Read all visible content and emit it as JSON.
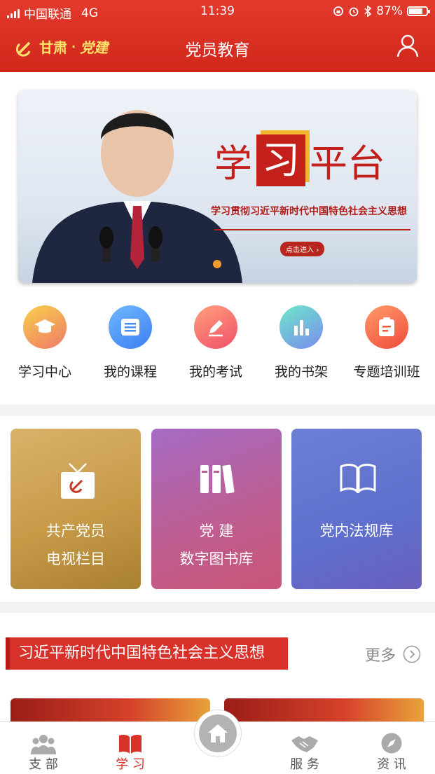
{
  "status": {
    "carrier": "中国联通",
    "network": "4G",
    "time": "11:39",
    "battery": "87%",
    "battery_level": 0.87
  },
  "nav": {
    "logo_text": "甘肃",
    "logo_sub": "党建",
    "logo_sep": "·",
    "title": "党员教育"
  },
  "banner": {
    "heading_left": "学",
    "heading_box": "习",
    "heading_right": "平台",
    "subtitle": "学习贯彻习近平新时代中国特色社会主义思想",
    "button": "点击进入",
    "button_arrow": "›"
  },
  "quick": [
    {
      "label": "学习中心",
      "icon": "graduation-cap-icon",
      "color_a": "#f7d04a",
      "color_b": "#f07a6a"
    },
    {
      "label": "我的课程",
      "icon": "course-list-icon",
      "color_a": "#6fb7ff",
      "color_b": "#3e7ff2"
    },
    {
      "label": "我的考试",
      "icon": "pencil-icon",
      "color_a": "#ffa07a",
      "color_b": "#f0506a"
    },
    {
      "label": "我的书架",
      "icon": "bar-chart-icon",
      "color_a": "#6ee7c8",
      "color_b": "#7a8cf0"
    },
    {
      "label": "专题培训班",
      "icon": "clipboard-icon",
      "color_a": "#ff9c6a",
      "color_b": "#ef4a3a"
    }
  ],
  "cards": [
    {
      "line1": "共产党员",
      "line2": "电视栏目",
      "icon": "tv-icon"
    },
    {
      "line1": "党 建",
      "line2": "数字图书库",
      "icon": "books-icon"
    },
    {
      "line1": "党内法规库",
      "line2": "",
      "icon": "open-book-icon"
    }
  ],
  "section": {
    "title": "习近平新时代中国特色社会主义思想",
    "more": "更多"
  },
  "tabs": [
    {
      "label": "支 部",
      "icon": "group-icon"
    },
    {
      "label": "学 习",
      "icon": "study-book-icon"
    },
    {
      "label": "服 务",
      "icon": "handshake-icon"
    },
    {
      "label": "资 讯",
      "icon": "compass-icon"
    }
  ],
  "colors": {
    "primary": "#d8312a",
    "inactive": "#555555"
  }
}
